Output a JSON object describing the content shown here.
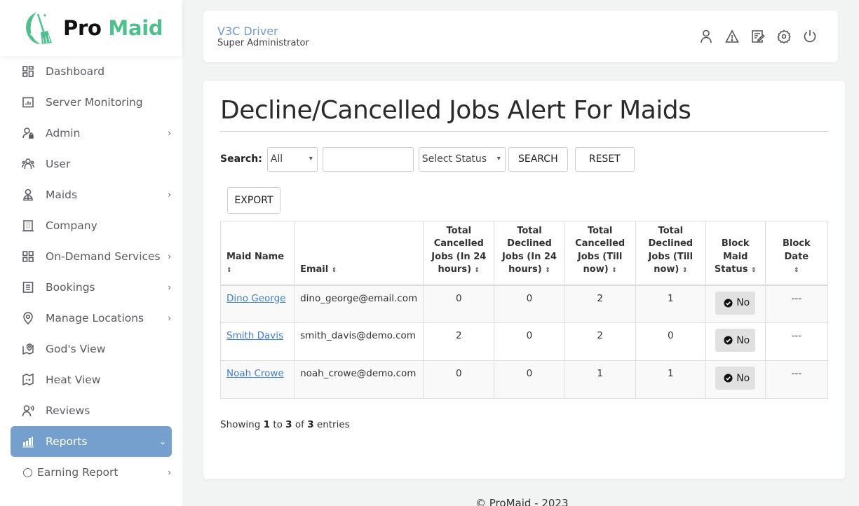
{
  "brand": {
    "name_part1": "Pro",
    "name_part2": "Maid",
    "accent_color": "#4fc08d"
  },
  "sidebar": {
    "items": [
      {
        "label": "Dashboard",
        "icon": "dashboard-icon",
        "has_submenu": false
      },
      {
        "label": "Server Monitoring",
        "icon": "server-monitoring-icon",
        "has_submenu": false
      },
      {
        "label": "Admin",
        "icon": "admin-lock-icon",
        "has_submenu": true
      },
      {
        "label": "User",
        "icon": "users-icon",
        "has_submenu": false
      },
      {
        "label": "Maids",
        "icon": "maid-icon",
        "has_submenu": true
      },
      {
        "label": "Company",
        "icon": "building-icon",
        "has_submenu": false
      },
      {
        "label": "On-Demand Services",
        "icon": "grid-icon",
        "has_submenu": true
      },
      {
        "label": "Bookings",
        "icon": "list-icon",
        "has_submenu": true
      },
      {
        "label": "Manage Locations",
        "icon": "location-pin-icon",
        "has_submenu": true
      },
      {
        "label": "God's View",
        "icon": "map-pin-icon",
        "has_submenu": false
      },
      {
        "label": "Heat View",
        "icon": "heat-map-icon",
        "has_submenu": false
      },
      {
        "label": "Reviews",
        "icon": "reviews-icon",
        "has_submenu": false
      },
      {
        "label": "Reports",
        "icon": "bar-chart-icon",
        "has_submenu": true,
        "active": true
      },
      {
        "label": "Earning Report",
        "icon": "circle-icon",
        "has_submenu": true,
        "sub": true
      }
    ],
    "active_color": "#759fcd"
  },
  "header": {
    "user_name": "V3C Driver",
    "user_role": "Super Administrator",
    "icons": [
      "profile-icon",
      "alert-icon",
      "edit-icon",
      "settings-icon",
      "power-icon"
    ]
  },
  "page": {
    "title": "Decline/Cancelled Jobs Alert For Maids",
    "search_label": "Search:",
    "filter_select_value": "All",
    "search_input_value": "",
    "status_select_value": "Select Status",
    "search_button": "SEARCH",
    "reset_button": "RESET",
    "export_button": "EXPORT"
  },
  "table": {
    "columns": [
      "Maid Name",
      "Email",
      "Total Cancelled Jobs (In 24 hours)",
      "Total Declined Jobs (In 24 hours)",
      "Total Cancelled Jobs (Till now)",
      "Total Declined Jobs (Till now)",
      "Block Maid Status",
      "Block Date"
    ],
    "rows": [
      {
        "name": "Dino George",
        "email": "dino_george@email.com",
        "cancelled_24h": "0",
        "declined_24h": "0",
        "cancelled_total": "2",
        "declined_total": "1",
        "block_status": "No",
        "block_date": "---"
      },
      {
        "name": "Smith Davis",
        "email": "smith_davis@demo.com",
        "cancelled_24h": "2",
        "declined_24h": "0",
        "cancelled_total": "2",
        "declined_total": "0",
        "block_status": "No",
        "block_date": "---"
      },
      {
        "name": "Noah Crowe",
        "email": "noah_crowe@demo.com",
        "cancelled_24h": "0",
        "declined_24h": "0",
        "cancelled_total": "1",
        "declined_total": "1",
        "block_status": "No",
        "block_date": "---"
      }
    ],
    "showing": {
      "prefix": "Showing",
      "from": "1",
      "to_word": "to",
      "to": "3",
      "of_word": "of",
      "total": "3",
      "suffix": "entries"
    }
  },
  "footer": {
    "text": "© ProMaid - 2023"
  }
}
